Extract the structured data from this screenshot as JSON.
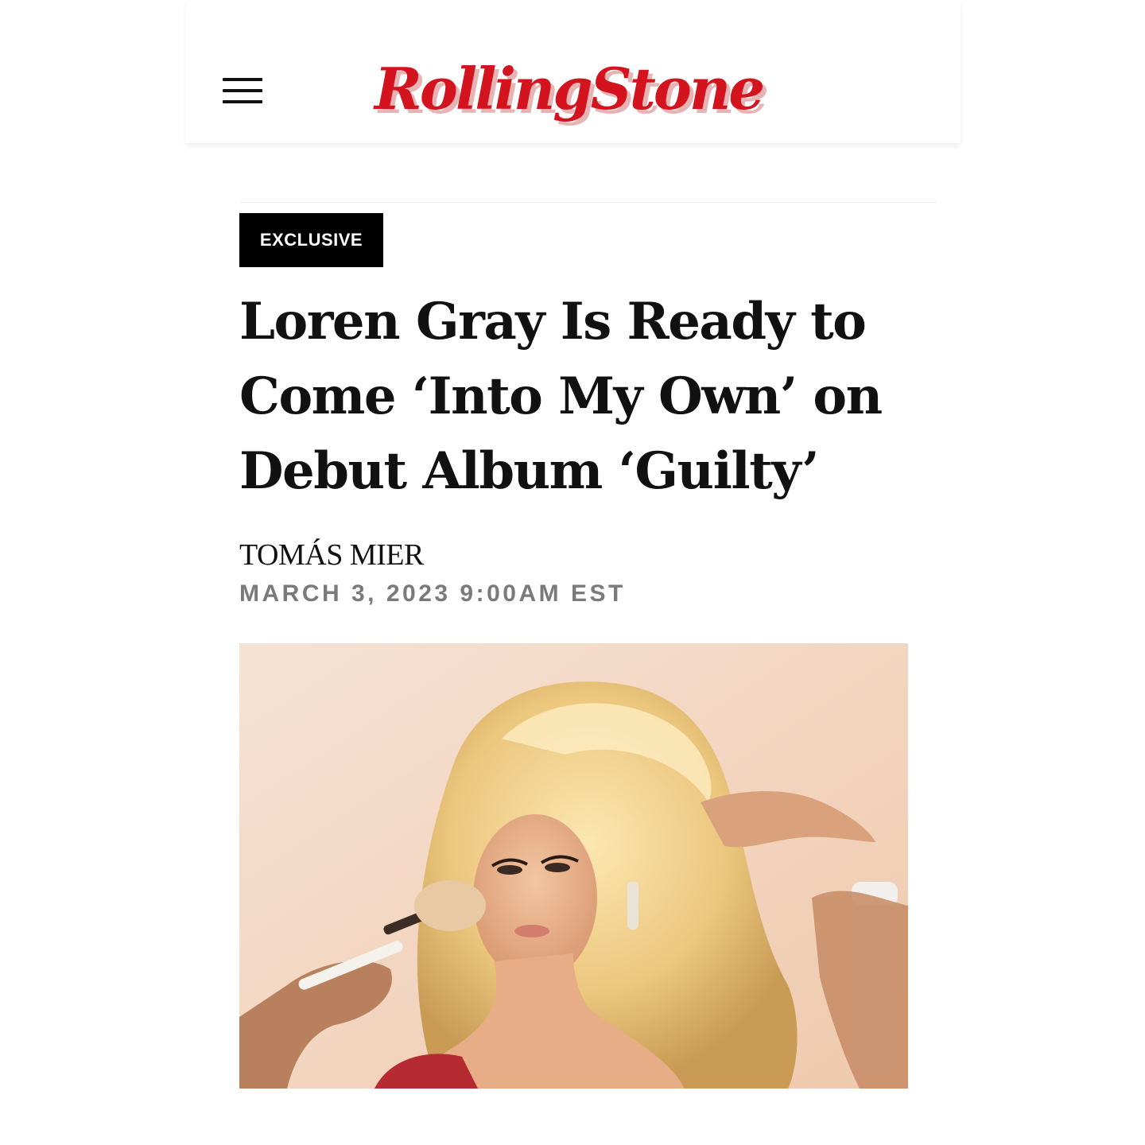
{
  "header": {
    "menu_icon": "hamburger-menu-icon",
    "logo_text": "RollingStone",
    "brand_color": "#d3141f"
  },
  "article": {
    "badge": "EXCLUSIVE",
    "headline_lines": [
      "Loren Gray Is Ready to",
      "Come ‘Into My Own’ on",
      "Debut Album ‘Guilty’"
    ],
    "author": "TOMÁS MIER",
    "date": "MARCH 3, 2023 9:00AM EST"
  }
}
